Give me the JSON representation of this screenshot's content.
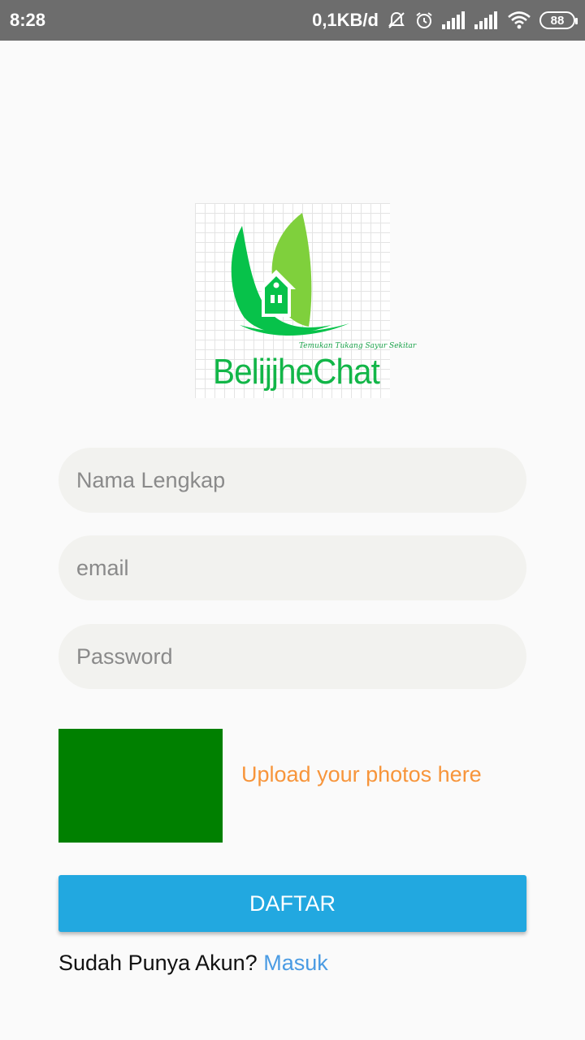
{
  "status_bar": {
    "time": "8:28",
    "network_speed": "0,1KB/d",
    "battery_level": "88",
    "icons": [
      "notifications-off-icon",
      "alarm-icon",
      "signal-icon",
      "signal-icon",
      "wifi-icon",
      "battery-icon"
    ]
  },
  "logo": {
    "tagline": "Temukan Tukang Sayur Sekitar",
    "brand": "BelijjheChat",
    "colors": {
      "leaf_dark": "#07c24a",
      "leaf_light": "#7fd03c",
      "text": "#12b648"
    }
  },
  "form": {
    "name_placeholder": "Nama Lengkap",
    "email_placeholder": "email",
    "password_placeholder": "Password",
    "name_value": "",
    "email_value": "",
    "password_value": ""
  },
  "photo": {
    "placeholder_color": "#008000",
    "upload_label": "Upload your photos here",
    "upload_color": "#f7953b"
  },
  "submit": {
    "label": "DAFTAR",
    "color": "#22a8e0"
  },
  "footer": {
    "question": "Sudah Punya Akun?",
    "login_link": "Masuk",
    "link_color": "#4a9be3"
  }
}
